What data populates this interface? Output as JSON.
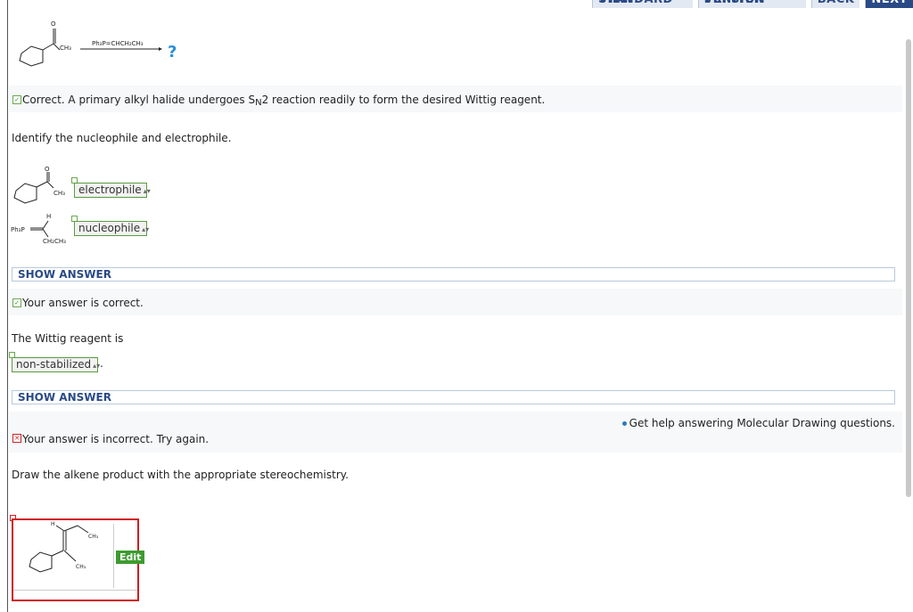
{
  "top_nav": [
    {
      "label": "STANDARD VIEW"
    },
    {
      "label": "PRINTER VERSION"
    },
    {
      "label": "BACK"
    },
    {
      "label": "NEXT"
    }
  ],
  "reaction": {
    "reagent": "Ph₃P=CHCH₂CH₃",
    "product_marker": "?",
    "reactant_label": "CH₃"
  },
  "feedback1": {
    "text_prefix": "Correct. A primary alkyl halide undergoes S",
    "text_sub": "N",
    "text_suffix": "2 reaction readily to form the desired Wittig reagent."
  },
  "question1": {
    "prompt": "Identify the nucleophile and electrophile.",
    "molecule1_label": "CH₃",
    "molecule1_answer": "electrophile",
    "molecule2_ph": "Ph₃P",
    "molecule2_h": "H",
    "molecule2_group": "CH₂CH₃",
    "molecule2_answer": "nucleophile",
    "show_answer": "SHOW ANSWER",
    "feedback": "Your answer is correct."
  },
  "question2": {
    "prompt": "The Wittig reagent is",
    "answer": "non-stabilized",
    "suffix": ".",
    "show_answer": "SHOW ANSWER"
  },
  "question3": {
    "help_link": "Get help answering Molecular Drawing questions.",
    "feedback": "Your answer is incorrect.  Try again.",
    "prompt": "Draw the alkene product with the appropriate stereochemistry.",
    "edit_label": "Edit",
    "drawing_h": "H",
    "drawing_ch3_top": "CH₃",
    "drawing_ch3_bottom": "CH₃"
  },
  "colors": {
    "correct": "#6aa84f",
    "incorrect": "#d01c22",
    "link_blue": "#2a4a86",
    "question_mark": "#2b8fd8"
  }
}
